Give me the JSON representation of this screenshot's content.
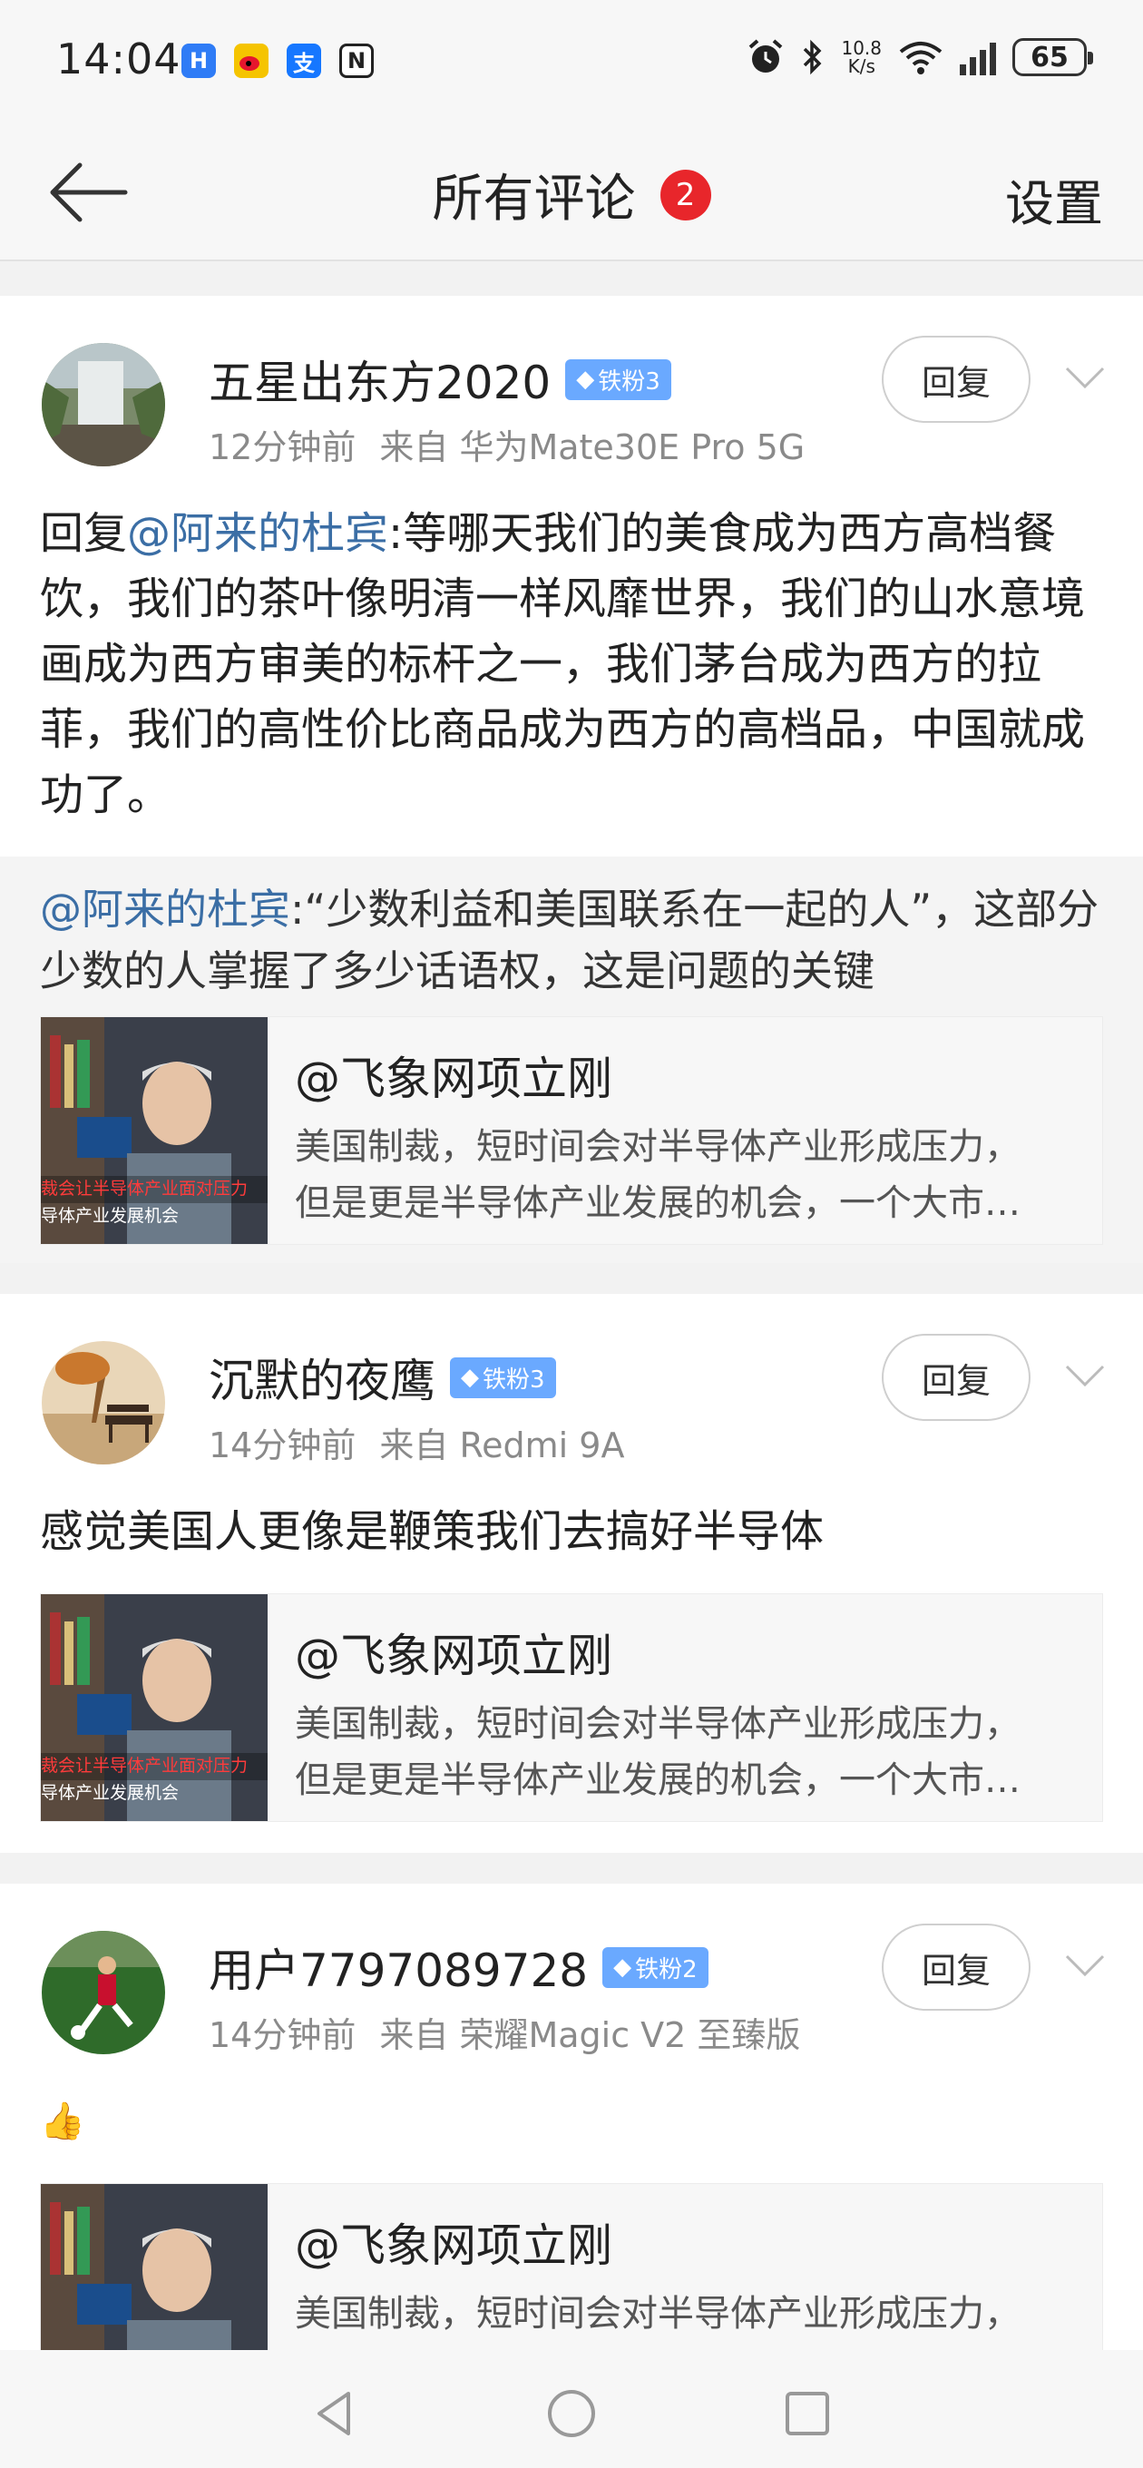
{
  "status_bar": {
    "time": "14:04",
    "net_speed_value": "10.8",
    "net_speed_unit": "K/s",
    "battery": "65",
    "app_icons": [
      "app-h-icon",
      "weibo-icon",
      "alipay-icon",
      "nfc-icon"
    ],
    "right_icons": [
      "alarm-icon",
      "bluetooth-icon",
      "wifi-6-icon",
      "signal-icon",
      "battery-icon"
    ]
  },
  "header": {
    "title": "所有评论",
    "badge_count": "2",
    "settings_label": "设置"
  },
  "comments": [
    {
      "username": "五星出东方2020",
      "fan_badge": "铁粉3",
      "time": "12分钟前",
      "device": "来自 华为Mate30E Pro 5G",
      "reply_label": "回复",
      "text_prefix": "回复",
      "text_mention": "@阿来的杜宾",
      "text_body": ":等哪天我们的美食成为西方高档餐饮，我们的茶叶像明清一样风靡世界，我们的山水意境画成为西方审美的标杆之一，我们茅台成为西方的拉菲，我们的高性价比商品成为西方的高档品，中国就成功了。",
      "quote_mention": "@阿来的杜宾",
      "quote_body": ":“少数利益和美国联系在一起的人”，这部分少数的人掌握了多少话语权，这是问题的关键",
      "video": {
        "title": "@飞象网项立刚",
        "desc_line1": "美国制裁，短时间会对半导体产业形成压力，",
        "desc_line2": "但是更是半导体产业发展的机会，一个大市…",
        "thumb_caption_1": "裁会让半导体产业面对压力",
        "thumb_caption_2": "导体产业发展机会"
      }
    },
    {
      "username": "沉默的夜鹰",
      "fan_badge": "铁粉3",
      "time": "14分钟前",
      "device": "来自 Redmi 9A",
      "reply_label": "回复",
      "text": "感觉美国人更像是鞭策我们去搞好半导体",
      "video": {
        "title": "@飞象网项立刚",
        "desc_line1": "美国制裁，短时间会对半导体产业形成压力，",
        "desc_line2": "但是更是半导体产业发展的机会，一个大市…",
        "thumb_caption_1": "裁会让半导体产业面对压力",
        "thumb_caption_2": "导体产业发展机会"
      }
    },
    {
      "username": "用户7797089728",
      "fan_badge": "铁粉2",
      "time": "14分钟前",
      "device": "来自 荣耀Magic V2 至臻版",
      "reply_label": "回复",
      "text": "👍",
      "video": {
        "title": "@飞象网项立刚",
        "desc_line1": "美国制裁，短时间会对半导体产业形成压力，"
      }
    }
  ]
}
